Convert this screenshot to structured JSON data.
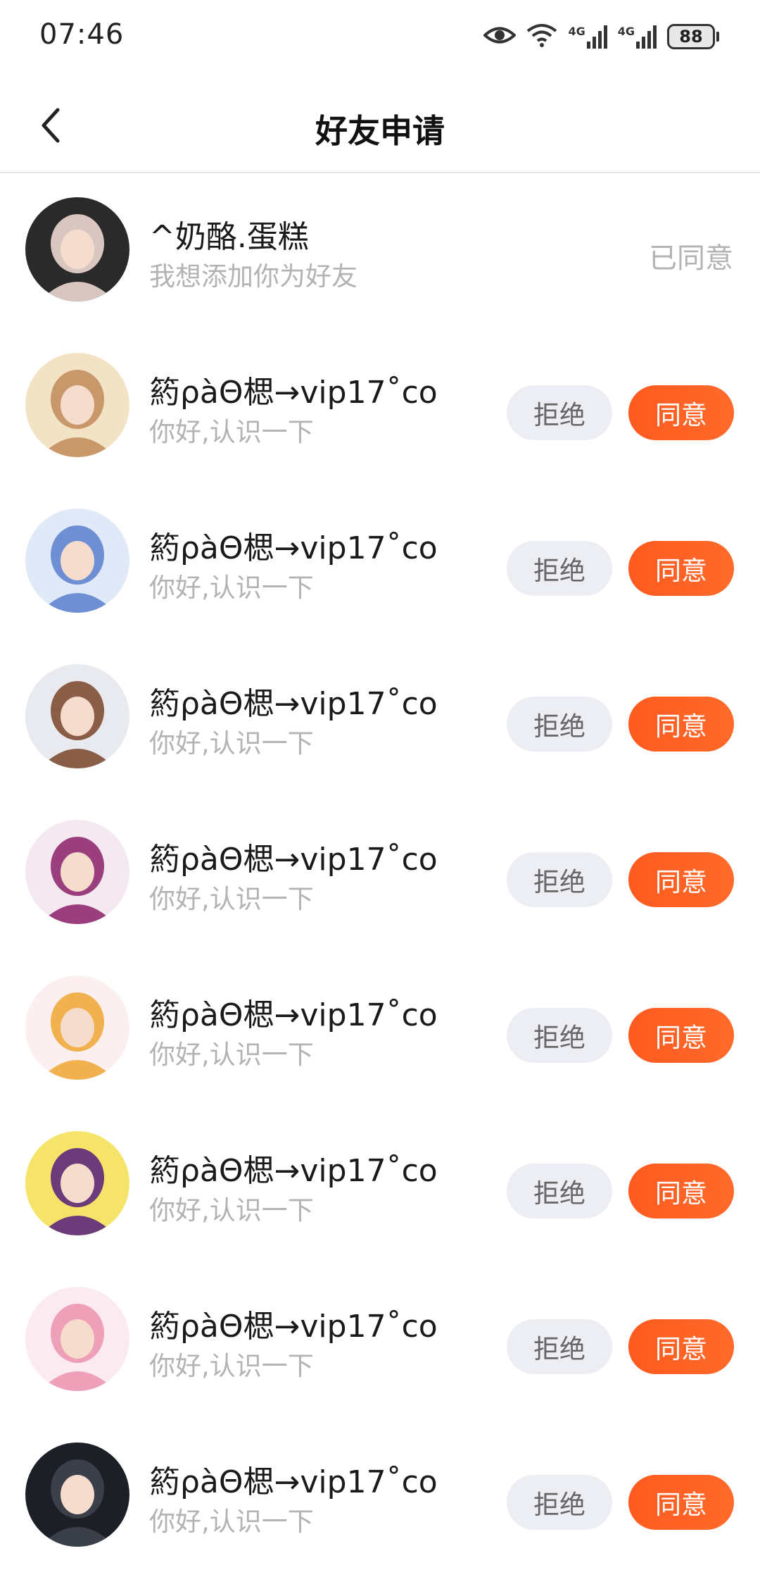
{
  "status_bar": {
    "time": "07:46",
    "battery": "88",
    "network_1": "4G",
    "network_2": "4G"
  },
  "header": {
    "title": "好友申请"
  },
  "requests": [
    {
      "name": "^奶酪.蛋糕",
      "message": "我想添加你为好友",
      "status": "已同意",
      "avatar_colors": [
        "#2a2a2a",
        "#d9c6c0"
      ]
    },
    {
      "name": "箹ρàΘ楒→vip17˚co",
      "message": "你好,认识一下",
      "reject": "拒绝",
      "accept": "同意",
      "avatar_colors": [
        "#f3e3c5",
        "#c9986a"
      ]
    },
    {
      "name": "箹ρàΘ楒→vip17˚co",
      "message": "你好,认识一下",
      "reject": "拒绝",
      "accept": "同意",
      "avatar_colors": [
        "#dfe9f7",
        "#6f8fd4"
      ]
    },
    {
      "name": "箹ρàΘ楒→vip17˚co",
      "message": "你好,认识一下",
      "reject": "拒绝",
      "accept": "同意",
      "avatar_colors": [
        "#e8eaef",
        "#8a5d46"
      ]
    },
    {
      "name": "箹ρàΘ楒→vip17˚co",
      "message": "你好,认识一下",
      "reject": "拒绝",
      "accept": "同意",
      "avatar_colors": [
        "#f4e8f1",
        "#9b3e7e"
      ]
    },
    {
      "name": "箹ρàΘ楒→vip17˚co",
      "message": "你好,认识一下",
      "reject": "拒绝",
      "accept": "同意",
      "avatar_colors": [
        "#fbf0ef",
        "#f0b14e"
      ]
    },
    {
      "name": "箹ρàΘ楒→vip17˚co",
      "message": "你好,认识一下",
      "reject": "拒绝",
      "accept": "同意",
      "avatar_colors": [
        "#f6e46a",
        "#6b3b7a"
      ]
    },
    {
      "name": "箹ρàΘ楒→vip17˚co",
      "message": "你好,认识一下",
      "reject": "拒绝",
      "accept": "同意",
      "avatar_colors": [
        "#fbeaf0",
        "#eea0b8"
      ]
    },
    {
      "name": "箹ρàΘ楒→vip17˚co",
      "message": "你好,认识一下",
      "reject": "拒绝",
      "accept": "同意",
      "avatar_colors": [
        "#1d1f26",
        "#3a3f4a"
      ]
    }
  ],
  "colors": {
    "accent": "#ff5a1f",
    "reject_bg": "#edeef3",
    "secondary_text": "#b3b3b3"
  }
}
